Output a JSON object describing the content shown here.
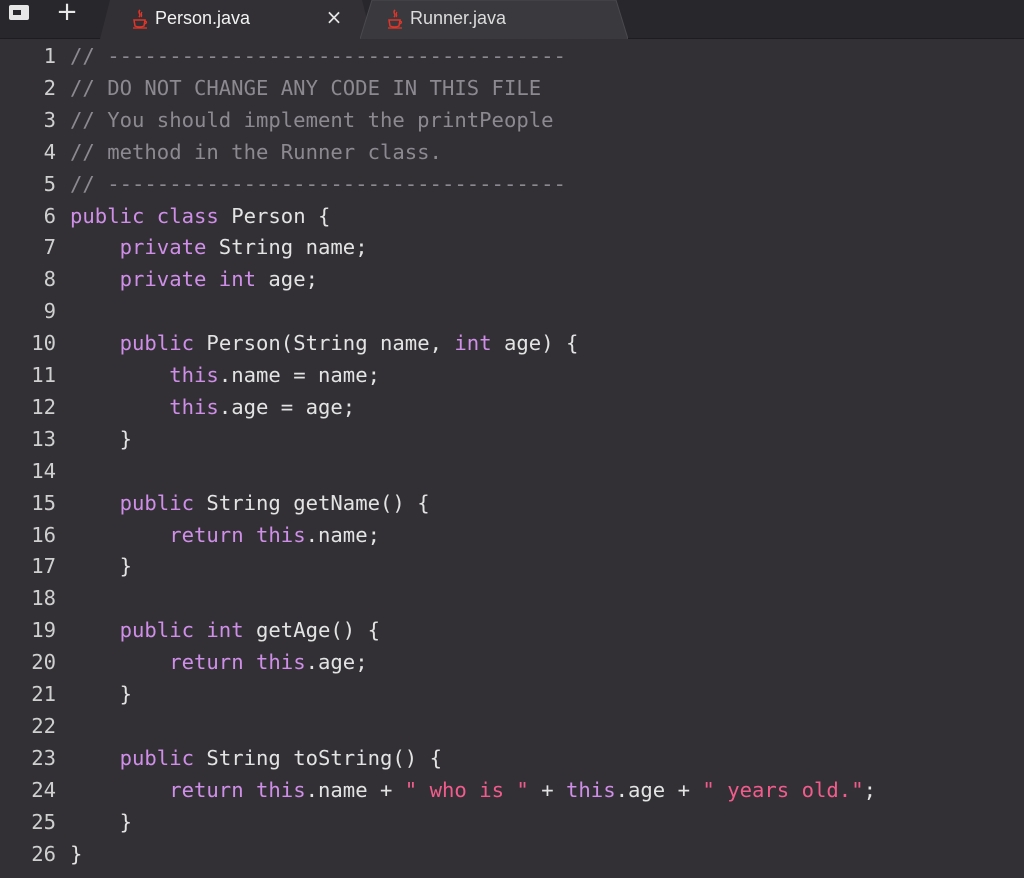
{
  "tabbar": {
    "panel_icon": "panel-toggle-icon",
    "new_tab_label": "+",
    "tabs": [
      {
        "label": "Person.java",
        "active": true,
        "icon": "java-icon",
        "close_label": "×"
      },
      {
        "label": "Runner.java",
        "active": false,
        "icon": "java-icon"
      }
    ]
  },
  "colors": {
    "background": "#323035",
    "tabbar": "#28272c",
    "keyword": "#cf8fe8",
    "comment": "#8c8a90",
    "string": "#f25c8c",
    "text": "#e3e3e3",
    "java_icon": "#e0362a"
  },
  "editor": {
    "lines": [
      {
        "n": "1",
        "tokens": [
          {
            "t": "// -------------------------------------",
            "c": "c"
          }
        ]
      },
      {
        "n": "2",
        "tokens": [
          {
            "t": "// DO NOT CHANGE ANY CODE IN THIS FILE",
            "c": "c"
          }
        ]
      },
      {
        "n": "3",
        "tokens": [
          {
            "t": "// You should implement the printPeople",
            "c": "c"
          }
        ]
      },
      {
        "n": "4",
        "tokens": [
          {
            "t": "// method in the Runner class.",
            "c": "c"
          }
        ]
      },
      {
        "n": "5",
        "tokens": [
          {
            "t": "// -------------------------------------",
            "c": "c"
          }
        ]
      },
      {
        "n": "6",
        "tokens": [
          {
            "t": "public class",
            "c": "k"
          },
          {
            "t": " Person {",
            "c": "p"
          }
        ]
      },
      {
        "n": "7",
        "tokens": [
          {
            "t": "    ",
            "c": "p"
          },
          {
            "t": "private",
            "c": "k"
          },
          {
            "t": " String name;",
            "c": "p"
          }
        ]
      },
      {
        "n": "8",
        "tokens": [
          {
            "t": "    ",
            "c": "p"
          },
          {
            "t": "private int",
            "c": "k"
          },
          {
            "t": " age;",
            "c": "p"
          }
        ]
      },
      {
        "n": "9",
        "tokens": []
      },
      {
        "n": "10",
        "tokens": [
          {
            "t": "    ",
            "c": "p"
          },
          {
            "t": "public",
            "c": "k"
          },
          {
            "t": " Person(String name, ",
            "c": "p"
          },
          {
            "t": "int",
            "c": "k"
          },
          {
            "t": " age) {",
            "c": "p"
          }
        ]
      },
      {
        "n": "11",
        "tokens": [
          {
            "t": "        ",
            "c": "p"
          },
          {
            "t": "this",
            "c": "k"
          },
          {
            "t": ".name = name;",
            "c": "p"
          }
        ]
      },
      {
        "n": "12",
        "tokens": [
          {
            "t": "        ",
            "c": "p"
          },
          {
            "t": "this",
            "c": "k"
          },
          {
            "t": ".age = age;",
            "c": "p"
          }
        ]
      },
      {
        "n": "13",
        "tokens": [
          {
            "t": "    }",
            "c": "p"
          }
        ]
      },
      {
        "n": "14",
        "tokens": []
      },
      {
        "n": "15",
        "tokens": [
          {
            "t": "    ",
            "c": "p"
          },
          {
            "t": "public",
            "c": "k"
          },
          {
            "t": " String getName() {",
            "c": "p"
          }
        ]
      },
      {
        "n": "16",
        "tokens": [
          {
            "t": "        ",
            "c": "p"
          },
          {
            "t": "return this",
            "c": "k"
          },
          {
            "t": ".name;",
            "c": "p"
          }
        ]
      },
      {
        "n": "17",
        "tokens": [
          {
            "t": "    }",
            "c": "p"
          }
        ]
      },
      {
        "n": "18",
        "tokens": []
      },
      {
        "n": "19",
        "tokens": [
          {
            "t": "    ",
            "c": "p"
          },
          {
            "t": "public int",
            "c": "k"
          },
          {
            "t": " getAge() {",
            "c": "p"
          }
        ]
      },
      {
        "n": "20",
        "tokens": [
          {
            "t": "        ",
            "c": "p"
          },
          {
            "t": "return this",
            "c": "k"
          },
          {
            "t": ".age;",
            "c": "p"
          }
        ]
      },
      {
        "n": "21",
        "tokens": [
          {
            "t": "    }",
            "c": "p"
          }
        ]
      },
      {
        "n": "22",
        "tokens": []
      },
      {
        "n": "23",
        "tokens": [
          {
            "t": "    ",
            "c": "p"
          },
          {
            "t": "public",
            "c": "k"
          },
          {
            "t": " String toString() {",
            "c": "p"
          }
        ]
      },
      {
        "n": "24",
        "tokens": [
          {
            "t": "        ",
            "c": "p"
          },
          {
            "t": "return this",
            "c": "k"
          },
          {
            "t": ".name + ",
            "c": "p"
          },
          {
            "t": "\" who is \"",
            "c": "s"
          },
          {
            "t": " + ",
            "c": "p"
          },
          {
            "t": "this",
            "c": "k"
          },
          {
            "t": ".age + ",
            "c": "p"
          },
          {
            "t": "\" years old.\"",
            "c": "s"
          },
          {
            "t": ";",
            "c": "p"
          }
        ]
      },
      {
        "n": "25",
        "tokens": [
          {
            "t": "    }",
            "c": "p"
          }
        ]
      },
      {
        "n": "26",
        "tokens": [
          {
            "t": "}",
            "c": "p"
          }
        ]
      }
    ]
  }
}
